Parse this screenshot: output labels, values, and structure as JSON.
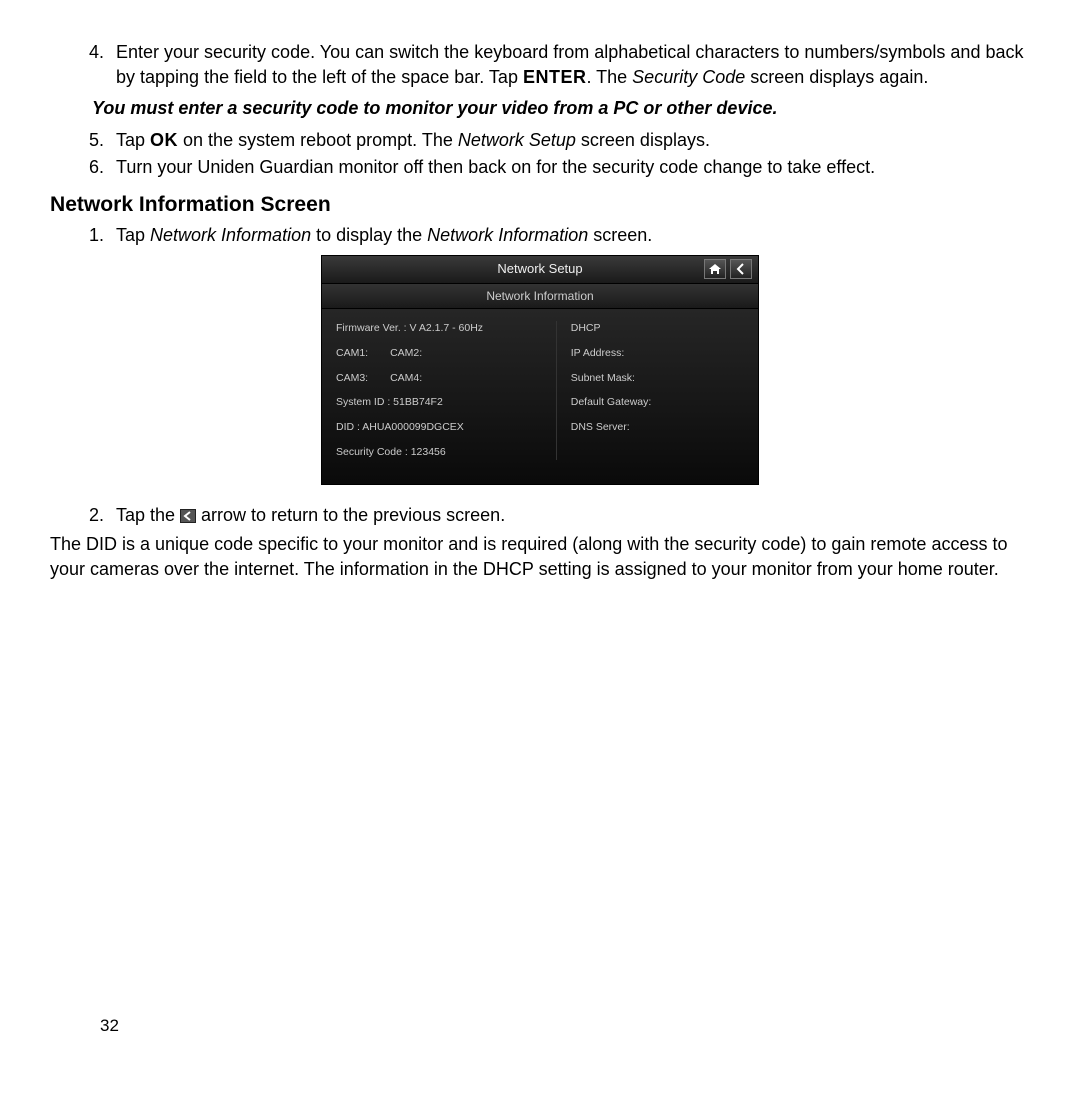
{
  "list1": {
    "item4": {
      "num": "4.",
      "pre": "Enter your security code. You can switch the keyboard from alphabetical characters to numbers/symbols and back by tapping the field to the left of the space bar. Tap ",
      "enter": "ENTER",
      "post": ". The ",
      "sc": "Security Code",
      "tail": " screen displays again."
    },
    "note": "You must enter a security code to monitor your video from a PC or other device.",
    "item5": {
      "num": "5.",
      "pre": "Tap ",
      "ok": "OK",
      "mid": " on the system reboot prompt. The ",
      "ns": "Network Setup",
      "tail": " screen displays."
    },
    "item6": {
      "num": "6.",
      "text": "Turn your Uniden Guardian monitor off then back on for the security code change to take effect."
    }
  },
  "heading": "Network Information Screen",
  "list2": {
    "item1": {
      "num": "1.",
      "pre": "Tap ",
      "ni": "Network Information",
      "mid": " to display the ",
      "ni2": "Network Information",
      "tail": " screen."
    },
    "item2": {
      "num": "2.",
      "pre": "Tap the ",
      "tail": " arrow to return to the previous screen."
    }
  },
  "device": {
    "title": "Network Setup",
    "subtitle": "Network Information",
    "left": {
      "firmware": "Firmware Ver. : V A2.1.7 - 60Hz",
      "cam1": "CAM1:",
      "cam2": "CAM2:",
      "cam3": "CAM3:",
      "cam4": "CAM4:",
      "sysid": "System ID : 51BB74F2",
      "did": "DID : AHUA000099DGCEX",
      "sec": "Security Code : 123456"
    },
    "right": {
      "dhcp": "DHCP",
      "ip": "IP Address:",
      "mask": "Subnet Mask:",
      "gw": "Default Gateway:",
      "dns": "DNS Server:"
    }
  },
  "para": "The DID is a unique code specific to your monitor and is required (along with the security code) to gain remote access to your cameras over the internet. The information in the DHCP setting is assigned to your monitor from your home router.",
  "pageNum": "32"
}
